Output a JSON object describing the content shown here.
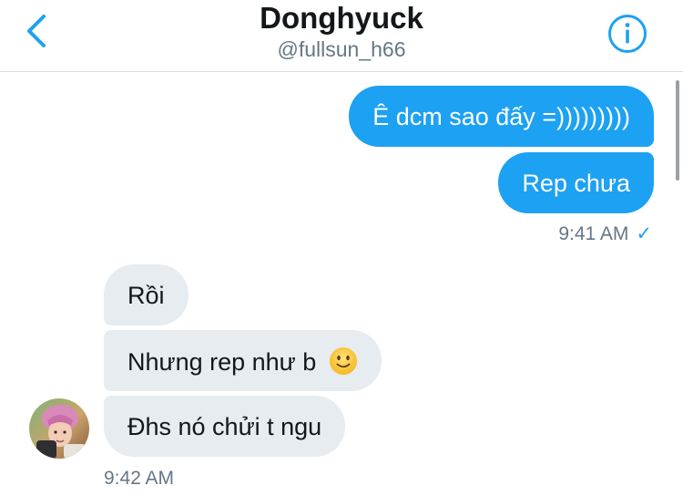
{
  "header": {
    "title": "Donghyuck",
    "handle": "@fullsun_h66",
    "back_icon": "chevron-left-icon",
    "info_icon": "info-icon",
    "accent": "#1da1f2"
  },
  "messages": {
    "sent": [
      {
        "text": "Ê dcm sao đấy =)))))))))"
      },
      {
        "text": "Rep chưa"
      }
    ],
    "sent_timestamp": "9:41 AM",
    "sent_status": "✓",
    "received": [
      {
        "text": "Rồi"
      },
      {
        "text": "Nhưng rep như b",
        "emoji": "slightly-smiling-face-icon"
      },
      {
        "text": "Đhs nó chửi t ngu"
      }
    ],
    "received_timestamp": "9:42 AM"
  },
  "colors": {
    "sent_bubble": "#1da1f2",
    "received_bubble": "#e6ecf0",
    "meta_text": "#657786"
  }
}
